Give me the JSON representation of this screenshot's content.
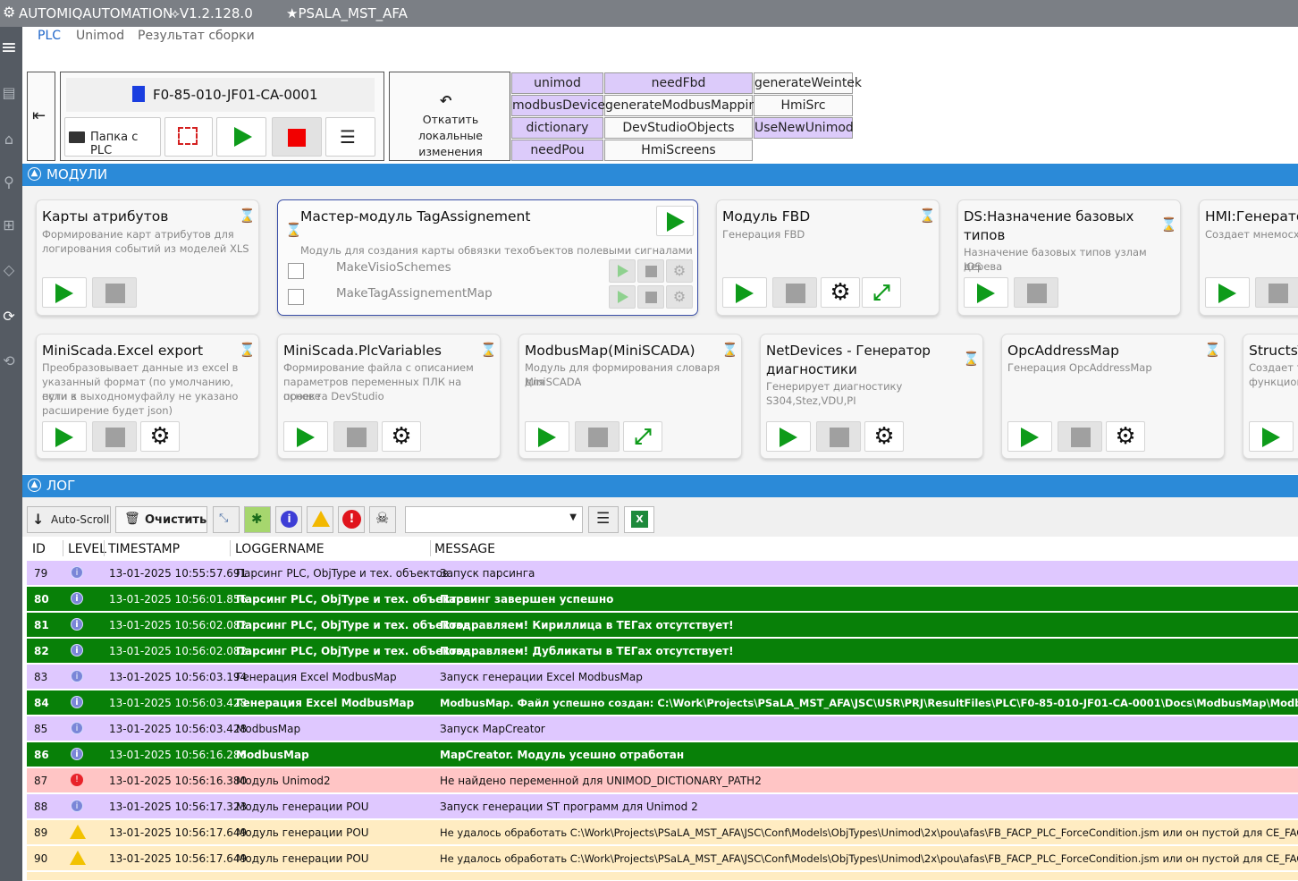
{
  "window": {
    "app_title": "AUTOMIQAUTOMATION",
    "version": "⟡V1.2.128.0",
    "project": "★PSALA_MST_AFA"
  },
  "nav": {
    "tabs": [
      "PLC",
      "Unimod",
      "Результат сборки"
    ]
  },
  "toolbar": {
    "project_name": "F0-85-010-JF01-CA-0001",
    "plc_folder_label": "Папка с PLC",
    "rollback_label_line1": "Откатить локальные",
    "rollback_label_line2": "изменения",
    "tags": [
      {
        "label": "unimod",
        "active": true
      },
      {
        "label": "needFbd",
        "active": true
      },
      {
        "label": "generateWeintek",
        "active": false
      },
      {
        "label": "modbusDevices",
        "active": true
      },
      {
        "label": "generateModbusMapping",
        "active": false
      },
      {
        "label": "HmiSrc",
        "active": false
      },
      {
        "label": "dictionary",
        "active": true
      },
      {
        "label": "DevStudioObjects",
        "active": false
      },
      {
        "label": "UseNewUnimod",
        "active": true
      },
      {
        "label": "needPou",
        "active": true
      },
      {
        "label": "HmiScreens",
        "active": false
      }
    ]
  },
  "modules_section": {
    "title": "МОДУЛИ"
  },
  "modules": [
    {
      "title": "Карты атрибутов",
      "desc1": "Формирование карт атрибутов для",
      "desc2": "логирования событий из моделей XLS"
    },
    {
      "title": "Мастер-модуль TagAssignement",
      "desc1": "Модуль для создания карты обвязки техобъектов полевыми сигналами",
      "sub1": "MakeVisioSchemes",
      "sub2": "MakeTagAssignementMap"
    },
    {
      "title": "Модуль FBD",
      "desc1": "Генерация FBD"
    },
    {
      "title1": "DS:Назначение базовых",
      "title2": "типов",
      "desc1": "Назначение базовых типов узлам дерева",
      "desc2": "IOS"
    },
    {
      "title": "HMI:Генерато",
      "desc1": "Создает мнемосхе"
    },
    {
      "title": "MiniScada.Excel export",
      "desc1": "Преобразовывает данные из excel в",
      "desc2": "указанный формат (по умолчанию, если в",
      "desc3": "пути к выходномуфайлу не указано",
      "desc4": "расширение будет json)"
    },
    {
      "title": "MiniScada.PlcVariables",
      "desc1": "Формирование файла с описанием",
      "desc2": "параметров переменных ПЛК на основе",
      "desc3": "проекта DevStudio"
    },
    {
      "title": "ModbusMap(MiniSCADA)",
      "desc1": "Модуль для формирования словаря для",
      "desc2": "MiniSCADA"
    },
    {
      "title1": "NetDevices - Генератор",
      "title2": "диагностики",
      "desc1": "Генерирует диагностику S304,Stez,VDU,PI"
    },
    {
      "title": "OpcAddressMap",
      "desc1": "Генерация OpcAddressMap"
    },
    {
      "title": "StructsT",
      "desc1": "Создает та",
      "desc2": "функцион"
    }
  ],
  "log_section": {
    "title": "ЛОГ"
  },
  "log_toolbar": {
    "autoscroll_label": "Auto-Scroll",
    "clear_label": "Очистить",
    "filter_value": ""
  },
  "log_columns": [
    "ID",
    "LEVEL",
    "TIMESTAMP",
    "LOGGERNAME",
    "MESSAGE"
  ],
  "log_rows": [
    {
      "id": "79",
      "level": "info",
      "ts": "13-01-2025 10:55:57.691",
      "logger": "Парсинг PLC, ObjType и тех. объектов",
      "msg": "Запуск парсинга",
      "style": "info"
    },
    {
      "id": "80",
      "level": "info",
      "ts": "13-01-2025 10:56:01.856",
      "logger": "Парсинг PLC, ObjType и тех. объектов",
      "msg": "Парсинг завершен успешно",
      "style": "ok"
    },
    {
      "id": "81",
      "level": "info",
      "ts": "13-01-2025 10:56:02.082",
      "logger": "Парсинг PLC, ObjType и тех. объектов",
      "msg": "Поздравляем! Кириллица в ТЕГах отсутствует!",
      "style": "ok"
    },
    {
      "id": "82",
      "level": "info",
      "ts": "13-01-2025 10:56:02.082",
      "logger": "Парсинг PLC, ObjType и тех. объектов",
      "msg": "Поздравляем! Дубликаты в ТЕГах отсутствует!",
      "style": "ok"
    },
    {
      "id": "83",
      "level": "info",
      "ts": "13-01-2025 10:56:03.194",
      "logger": "Генерация Excel ModbusMap",
      "msg": "Запуск генерации Excel ModbusMap",
      "style": "info"
    },
    {
      "id": "84",
      "level": "info",
      "ts": "13-01-2025 10:56:03.428",
      "logger": "Генерация Excel ModbusMap",
      "msg": "ModbusMap. Файл успешно создан: C:\\Work\\Projects\\PSaLA_MST_AFA\\JSC\\USR\\PRJ\\ResultFiles\\PLC\\F0-85-010-JF01-CA-0001\\Docs\\ModbusMap\\ModbusMap.xls",
      "style": "ok"
    },
    {
      "id": "85",
      "level": "info",
      "ts": "13-01-2025 10:56:03.428",
      "logger": "ModbusMap",
      "msg": "Запуск MapCreator",
      "style": "info"
    },
    {
      "id": "86",
      "level": "info",
      "ts": "13-01-2025 10:56:16.286",
      "logger": "ModbusMap",
      "msg": "MapCreator. Модуль усешно отработан",
      "style": "ok"
    },
    {
      "id": "87",
      "level": "error",
      "ts": "13-01-2025 10:56:16.380",
      "logger": "Модуль Unimod2",
      "msg": "Не найдено переменной для UNIMOD_DICTIONARY_PATH2",
      "style": "err"
    },
    {
      "id": "88",
      "level": "info",
      "ts": "13-01-2025 10:56:17.323",
      "logger": "Модуль генерации POU",
      "msg": "Запуск генерации ST программ для Unimod 2",
      "style": "info"
    },
    {
      "id": "89",
      "level": "warn",
      "ts": "13-01-2025 10:56:17.649",
      "logger": "Модуль генерации POU",
      "msg": "Не удалось обработать C:\\Work\\Projects\\PSaLA_MST_AFA\\JSC\\Conf\\Models\\ObjTypes\\Unimod\\2x\\pou\\afas\\FB_FACP_PLC_ForceCondition.jsm или он пустой для CE_FACP",
      "style": "warn"
    },
    {
      "id": "90",
      "level": "warn",
      "ts": "13-01-2025 10:56:17.649",
      "logger": "Модуль генерации POU",
      "msg": "Не удалось обработать C:\\Work\\Projects\\PSaLA_MST_AFA\\JSC\\Conf\\Models\\ObjTypes\\Unimod\\2x\\pou\\afas\\FB_FACP_PLC_ForceCondition.jsm или он пустой для CE_FACP",
      "style": "warn"
    }
  ]
}
